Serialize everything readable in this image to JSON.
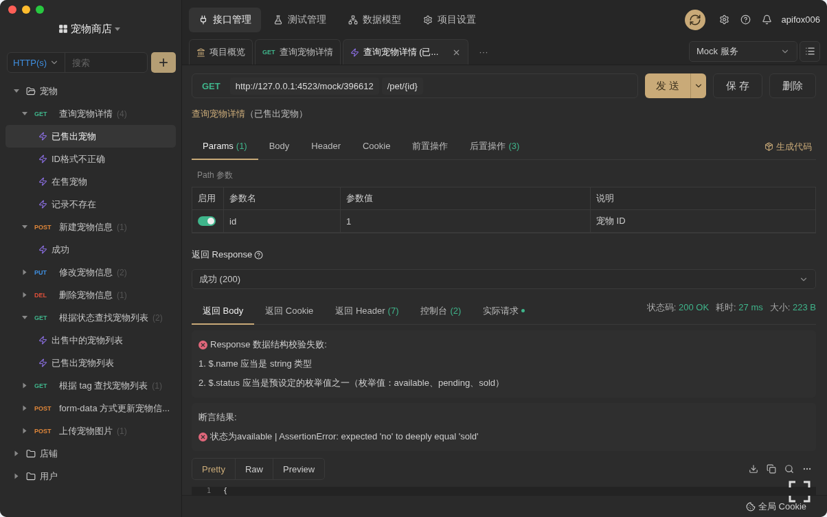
{
  "sidebar": {
    "project": "宠物商店",
    "protocol": "HTTP(s)",
    "search": {
      "placeholder": "搜索"
    },
    "add": "+",
    "tree": [
      {
        "kind": "folder",
        "name": "宠物",
        "expanded": true,
        "children": [
          {
            "kind": "endpoint",
            "method": "GET",
            "name": "查询宠物详情",
            "count": "(4)",
            "expanded": true,
            "children": [
              {
                "kind": "case",
                "name": "已售出宠物",
                "selected": true
              },
              {
                "kind": "case",
                "name": "ID格式不正确",
                "selected": false
              },
              {
                "kind": "case",
                "name": "在售宠物",
                "selected": false
              },
              {
                "kind": "case",
                "name": "记录不存在",
                "selected": false
              }
            ]
          },
          {
            "kind": "endpoint",
            "method": "POST",
            "name": "新建宠物信息",
            "count": "(1)",
            "expanded": true,
            "children": [
              {
                "kind": "case",
                "name": "成功",
                "selected": false
              }
            ]
          },
          {
            "kind": "endpoint",
            "method": "PUT",
            "name": "修改宠物信息",
            "count": "(2)",
            "expanded": false
          },
          {
            "kind": "endpoint",
            "method": "DEL",
            "name": "删除宠物信息",
            "count": "(1)",
            "expanded": false
          },
          {
            "kind": "endpoint",
            "method": "GET",
            "name": "根据状态查找宠物列表",
            "count": "(2)",
            "expanded": true,
            "children": [
              {
                "kind": "case",
                "name": "出售中的宠物列表",
                "selected": false
              },
              {
                "kind": "case",
                "name": "已售出宠物列表",
                "selected": false
              }
            ]
          },
          {
            "kind": "endpoint",
            "method": "GET",
            "name": "根据 tag 查找宠物列表",
            "count": "(1)",
            "expanded": false
          },
          {
            "kind": "endpoint",
            "method": "POST",
            "name": "form-data 方式更新宠物信...",
            "expanded": false
          },
          {
            "kind": "endpoint",
            "method": "POST",
            "name": "上传宠物图片",
            "count": "(1)",
            "expanded": false
          }
        ]
      },
      {
        "kind": "folder",
        "name": "店铺",
        "expanded": false
      },
      {
        "kind": "folder",
        "name": "用户",
        "expanded": false
      }
    ]
  },
  "nav": [
    {
      "label": "接口管理",
      "selected": true
    },
    {
      "label": "测试管理",
      "selected": false
    },
    {
      "label": "数据模型",
      "selected": false
    },
    {
      "label": "项目设置",
      "selected": false
    }
  ],
  "user": "apifox006",
  "doc_tabs": [
    {
      "kind": "overview",
      "label": "项目概览",
      "selected": false
    },
    {
      "kind": "endpoint",
      "method": "GET",
      "label": "查询宠物详情",
      "selected": false
    },
    {
      "kind": "case",
      "label": "查询宠物详情 (已...",
      "selected": true
    }
  ],
  "more_tabs": "···",
  "environment": "Mock 服务",
  "request": {
    "method": "GET",
    "base_url": "http://127.0.0.1:4523/mock/396612",
    "path": "/pet/{id}",
    "send": "发 送",
    "save": "保 存",
    "delete": "删除"
  },
  "breadcrumb": {
    "endpoint": "查询宠物详情",
    "case": "（已售出宠物）"
  },
  "param_tabs": [
    {
      "label": "Params",
      "count": "(1)",
      "selected": true
    },
    {
      "label": "Body",
      "selected": false
    },
    {
      "label": "Header",
      "selected": false
    },
    {
      "label": "Cookie",
      "selected": false
    },
    {
      "label": "前置操作",
      "selected": false
    },
    {
      "label": "后置操作",
      "count": "(3)",
      "selected": false
    }
  ],
  "generate_code": "生成代码",
  "path_params": {
    "title": "Path 参数",
    "columns": [
      "启用",
      "参数名",
      "参数值",
      "说明"
    ],
    "rows": [
      {
        "enabled": true,
        "name": "id",
        "value": "1",
        "description": "宠物 ID"
      }
    ]
  },
  "response": {
    "label": "返回 Response",
    "selected": "成功 (200)"
  },
  "result_tabs": [
    {
      "label": "返回 Body",
      "selected": true
    },
    {
      "label": "返回 Cookie",
      "selected": false
    },
    {
      "label": "返回 Header",
      "count": "(7)",
      "selected": false
    },
    {
      "label": "控制台",
      "count": "(2)",
      "selected": false
    },
    {
      "label": "实际请求",
      "dot": true,
      "selected": false
    }
  ],
  "stats": [
    {
      "label": "状态码:",
      "value": "200 OK"
    },
    {
      "label": "耗时:",
      "value": "27 ms"
    },
    {
      "label": "大小:",
      "value": "223 B"
    }
  ],
  "validation": {
    "title": "Response 数据结构校验失败:",
    "errors": [
      "1. $.name 应当是 string 类型",
      "2. $.status 应当是预设定的枚举值之一（枚举值：available、pending、sold）"
    ]
  },
  "assertions": {
    "title": "断言结果:",
    "items": [
      "状态为available | AssertionError: expected 'no' to deeply equal 'sold'"
    ]
  },
  "view_tabs": [
    {
      "label": "Pretty",
      "selected": true
    },
    {
      "label": "Raw",
      "selected": false
    },
    {
      "label": "Preview",
      "selected": false
    }
  ],
  "code": [
    {
      "number": "1",
      "text": "{"
    }
  ],
  "footer": "全局 Cookie"
}
